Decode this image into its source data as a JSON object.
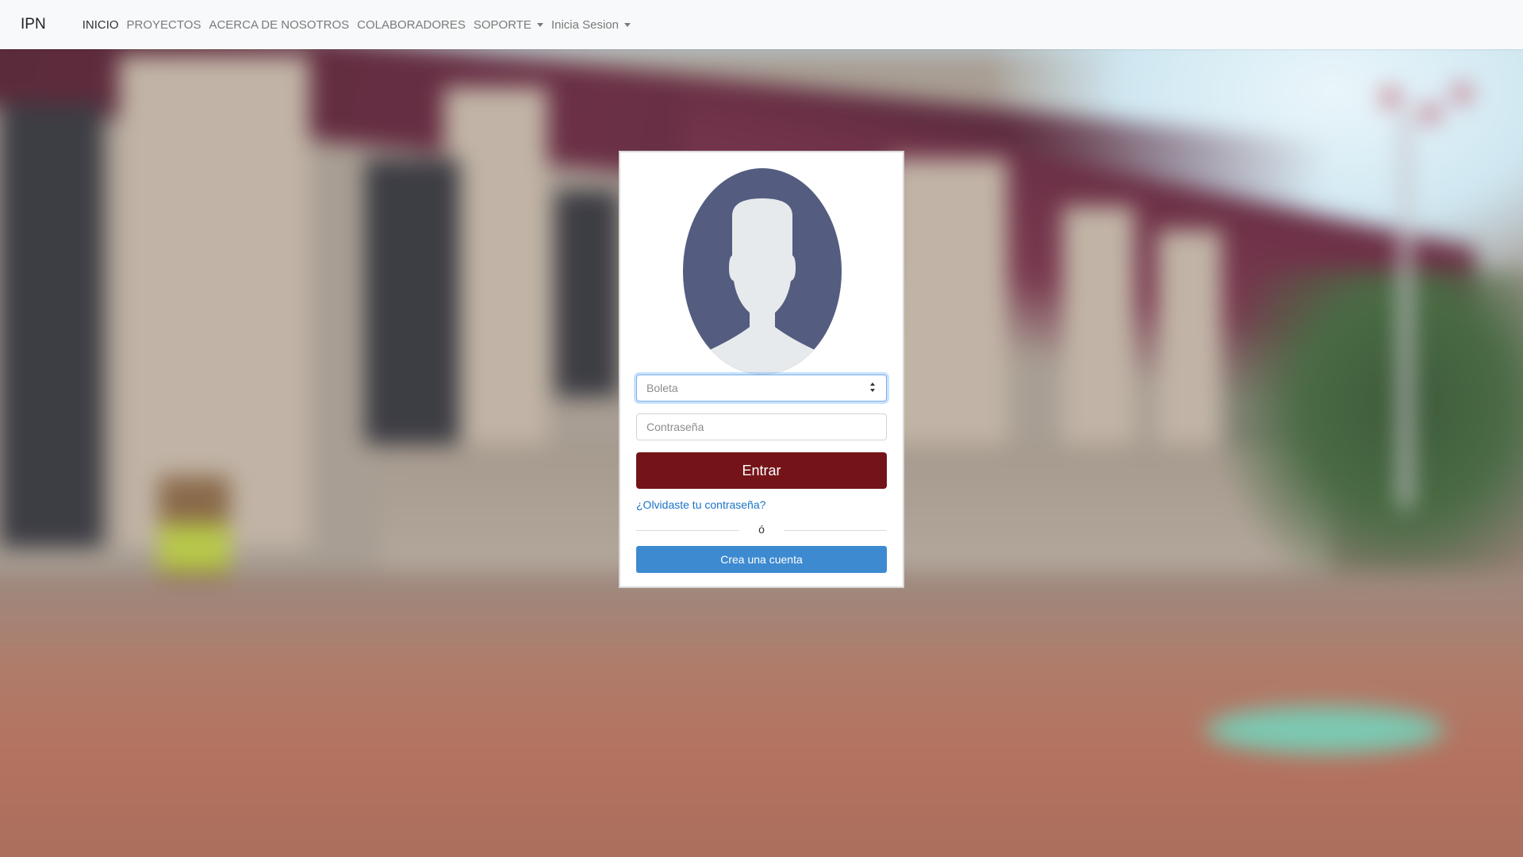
{
  "navbar": {
    "brand": "IPN",
    "items": [
      {
        "label": "INICIO",
        "active": true,
        "dropdown": false
      },
      {
        "label": "PROYECTOS",
        "active": false,
        "dropdown": false
      },
      {
        "label": "ACERCA DE NOSOTROS",
        "active": false,
        "dropdown": false
      },
      {
        "label": "COLABORADORES",
        "active": false,
        "dropdown": false
      },
      {
        "label": "SOPORTE",
        "active": false,
        "dropdown": true
      },
      {
        "label": "Inicia Sesion",
        "active": false,
        "dropdown": true
      }
    ]
  },
  "login": {
    "avatar_icon": "user-silhouette-icon",
    "boleta_placeholder": "Boleta",
    "password_placeholder": "Contraseña",
    "submit_label": "Entrar",
    "forgot_label": "¿Olvidaste tu contraseña?",
    "divider_text": "ó",
    "create_label": "Crea una cuenta"
  },
  "colors": {
    "enter_button": "#741419",
    "create_button": "#3d8ad1",
    "link": "#1a73c8",
    "avatar_bg": "#545d7f"
  }
}
